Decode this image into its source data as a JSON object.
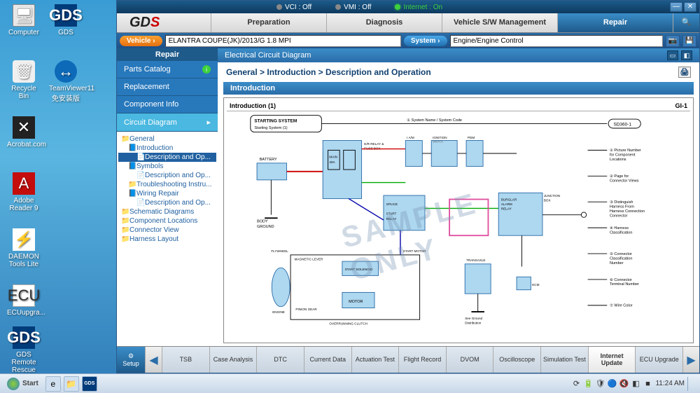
{
  "desktop": {
    "icons": [
      {
        "label": "Computer",
        "cls": "ico-computer",
        "glyph": "🖥"
      },
      {
        "label": "GDS",
        "cls": "ico-gds",
        "glyph": "GDS"
      },
      {
        "label": "Recycle Bin",
        "cls": "ico-recycle",
        "glyph": "🗑"
      },
      {
        "label": "TeamViewer11\n免安装版",
        "cls": "ico-teamviewer",
        "glyph": "↔"
      },
      {
        "label": "Acrobat.com",
        "cls": "ico-acrobat",
        "glyph": "✕"
      },
      {
        "label": "Adobe Reader 9",
        "cls": "ico-reader",
        "glyph": "A"
      },
      {
        "label": "DAEMON Tools Lite",
        "cls": "ico-daemon",
        "glyph": "⚡"
      },
      {
        "label": "ECUupgra...",
        "cls": "ico-ecu",
        "glyph": "ECU"
      },
      {
        "label": "GDS Remote Rescue",
        "cls": "ico-gdsremote",
        "glyph": "GDS"
      }
    ],
    "positions": [
      [
        10,
        6
      ],
      [
        70,
        6
      ],
      [
        10,
        86
      ],
      [
        70,
        86
      ],
      [
        10,
        166
      ],
      [
        10,
        246
      ],
      [
        10,
        326
      ],
      [
        10,
        406
      ],
      [
        10,
        466
      ]
    ]
  },
  "titlebar": {
    "vci": "VCI : Off",
    "vmi": "VMI : Off",
    "internet": "Internet : On"
  },
  "tabs": [
    "Preparation",
    "Diagnosis",
    "Vehicle S/W Management",
    "Repair"
  ],
  "activeTab": 3,
  "vehicle": {
    "btn": "Vehicle  ›",
    "value": "ELANTRA COUPE(JK)/2013/G 1.8 MPI"
  },
  "system": {
    "btn": "System  ›",
    "value": "Engine/Engine Control"
  },
  "sidebar": {
    "head": "Repair",
    "items": [
      {
        "label": "Parts Catalog",
        "info": true
      },
      {
        "label": "Replacement"
      },
      {
        "label": "Component Info"
      },
      {
        "label": "Circuit Diagram",
        "selected": true,
        "chevron": "▸"
      }
    ],
    "tree": [
      {
        "l": "General",
        "i": "📁",
        "d": 0
      },
      {
        "l": "Introduction",
        "i": "📘",
        "d": 1
      },
      {
        "l": "Description and Op...",
        "i": "📄",
        "d": 2,
        "sel": true
      },
      {
        "l": "Symbols",
        "i": "📘",
        "d": 1
      },
      {
        "l": "Description and Op...",
        "i": "📄",
        "d": 2
      },
      {
        "l": "Troubleshooting  Instru...",
        "i": "📁",
        "d": 1
      },
      {
        "l": "Wiring Repair",
        "i": "📘",
        "d": 1
      },
      {
        "l": "Description and Op...",
        "i": "📄",
        "d": 2
      },
      {
        "l": "Schematic Diagrams",
        "i": "📁",
        "d": 0
      },
      {
        "l": "Component Locations",
        "i": "📁",
        "d": 0
      },
      {
        "l": "Connector View",
        "i": "📁",
        "d": 0
      },
      {
        "l": "Harness Layout",
        "i": "📁",
        "d": 0
      }
    ]
  },
  "content": {
    "title": "Electrical Circuit Diagram",
    "breadcrumb": "General > Introduction > Description and Operation",
    "section": "Introduction",
    "docTitle": "Introduction (1)",
    "docCode": "GI-1",
    "watermark": "SAMPLE ONLY",
    "diagram": {
      "startLabel": "STARTING SYSTEM",
      "subLabel": "Starting System (1)",
      "sysNameNote": "① System Name / System Code",
      "sdCode": "SD360-1",
      "legend": [
        "① Picture Number for Component Locations",
        "② Page for Connector Views",
        "③ Distinguish Harness From Harness Connection Connector",
        "④ Harness Classification",
        "⑤ Connector Classification Number",
        "⑥ Connector Terminal Number",
        "⑦ Wire Color"
      ],
      "labels": {
        "battery": "BATTERY",
        "ejb": "E/R RELAY & FUSE BOX",
        "ignsw": "IGNITION SWITCH",
        "bcm": "BCM",
        "pdm": "PDM",
        "body": "BODY GROUND",
        "startRelay": "START RELAY",
        "splice": "SPLICE",
        "burglar": "BURGLAR ALARM RELAY",
        "junction": "JUNCTION BOX",
        "startMotor": "START MOTOR",
        "solenoid": "START SOLENOID",
        "flywheel": "FLYWHEEL",
        "maglever": "MAGNETIC LEVER",
        "piniongear": "PINION GEAR",
        "overrun": "OVERRUNNING CLUTCH",
        "engine": "ENGINE",
        "motor": "MOTOR",
        "ecm": "ECM",
        "transaxle": "TRANSAXLE RANGE SWITCH",
        "seeGround": "See Ground Distribution"
      }
    }
  },
  "bottom": {
    "setup": "Setup",
    "tabs": [
      "TSB",
      "Case Analysis",
      "DTC",
      "Current Data",
      "Actuation Test",
      "Flight Record",
      "DVOM",
      "Oscilloscope",
      "Simulation Test",
      "Internet Update",
      "ECU Upgrade"
    ],
    "active": 9
  },
  "taskbar": {
    "start": "Start",
    "clock": "11:24 AM",
    "tray": [
      "⟳",
      "🔋",
      "🛡",
      "🔵",
      "🔇",
      "◧",
      "■"
    ]
  }
}
